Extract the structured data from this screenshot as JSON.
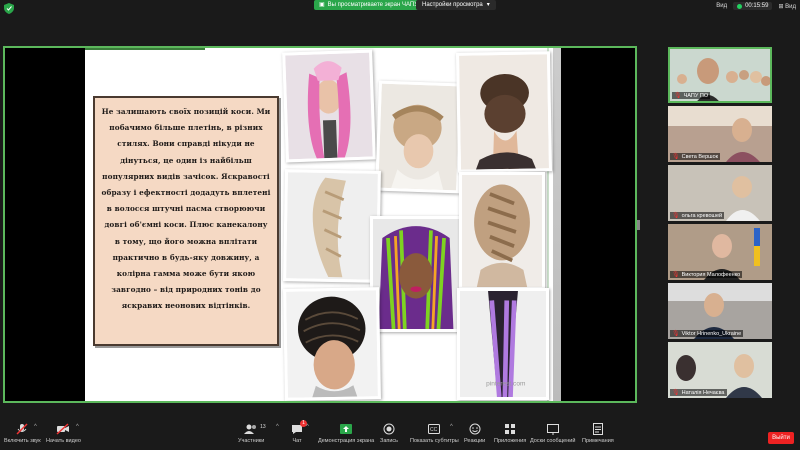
{
  "topbar": {
    "share_notice": "Вы просматриваете экран ЧАПУ ПО",
    "view_settings": "Настройки просмотра",
    "view_label_left": "Вид",
    "timer": "00:15:59",
    "view_label_right": "Вид"
  },
  "slide": {
    "text": "Не залишають своїх позицій коси. Ми побачимо більше плетінь, в різних стилях. Вони справді нікуди не дінуться, це один із найбільш популярних видів зачісок. Яскравості образу і ефектності додадуть вплетені в волосся штучні пасма створюючи довгі об'ємні коси. Плюс канекалону в тому, що його можна вплітати практично в будь-яку довжину, а колірна гамма може бути якою завгодно – від природних тонів до яскравих неонових відтінків.",
    "watermark": "pinterest.com"
  },
  "participants": [
    {
      "name": "ЧАПУ ПО"
    },
    {
      "name": "Света Вершок"
    },
    {
      "name": "ольга кревошей"
    },
    {
      "name": "Виктория Малофеенко"
    },
    {
      "name": "Viktor Hrinenko_Ukraine"
    },
    {
      "name": "Наталія Нечаєва"
    }
  ],
  "toolbar": {
    "mute": "Включить звук",
    "video": "Начать видео",
    "participants": "Участники",
    "participants_count": "13",
    "chat": "Чат",
    "chat_badge": "1",
    "share": "Демонстрация экрана",
    "record": "Запись",
    "subtitles": "Показать субтитры",
    "reactions": "Реакции",
    "apps": "Приложения",
    "whiteboard": "Доски сообщений",
    "notes": "Примечания",
    "leave": "Выйти"
  },
  "colors": {
    "accent_green": "#5cb85c",
    "share_green": "#2aa64a",
    "leave_red": "#e22222",
    "text_panel_bg": "#f5d9c4"
  }
}
